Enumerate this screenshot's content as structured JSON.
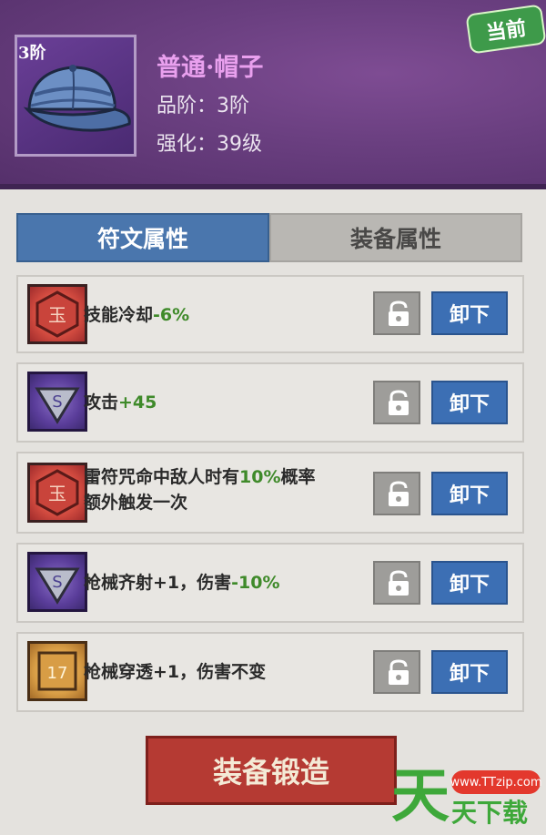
{
  "header": {
    "current_badge": "当前",
    "tier_tag": "3阶",
    "item_name": "普通·帽子",
    "quality_line": "品阶：3阶",
    "enhance_line": "强化：39级"
  },
  "tabs": [
    {
      "label": "符文属性",
      "active": true
    },
    {
      "label": "装备属性",
      "active": false
    }
  ],
  "runes": [
    {
      "rune": "red-hex-rune-icon",
      "text_parts": [
        "技能冷却",
        "-6%",
        ""
      ],
      "unload_label": "卸下"
    },
    {
      "rune": "purple-shield-rune-icon",
      "text_parts": [
        "攻击",
        "+45",
        ""
      ],
      "unload_label": "卸下"
    },
    {
      "rune": "red-hex-rune-icon",
      "text_parts": [
        "雷符咒命中敌人时有",
        "10%",
        "概率"
      ],
      "line2": "额外触发一次",
      "unload_label": "卸下"
    },
    {
      "rune": "purple-shield-rune-icon",
      "text_parts": [
        "枪械齐射+1，伤害",
        "-10%",
        ""
      ],
      "unload_label": "卸下"
    },
    {
      "rune": "gold-square-rune-icon",
      "text_parts": [
        "枪械穿透+1，伤害不变",
        "",
        ""
      ],
      "unload_label": "卸下"
    }
  ],
  "forge_button": "装备锻造",
  "watermark": {
    "url": "www.TTzip.com",
    "big_char": "天",
    "small_text": "天下载"
  },
  "colors": {
    "header_purple": "#6a3f80",
    "tab_active": "#4a76ad",
    "unload_button": "#3c6fb4",
    "forge_button": "#b53a33",
    "positive_value": "#3f8a2a",
    "item_name": "#e9a0ee"
  }
}
